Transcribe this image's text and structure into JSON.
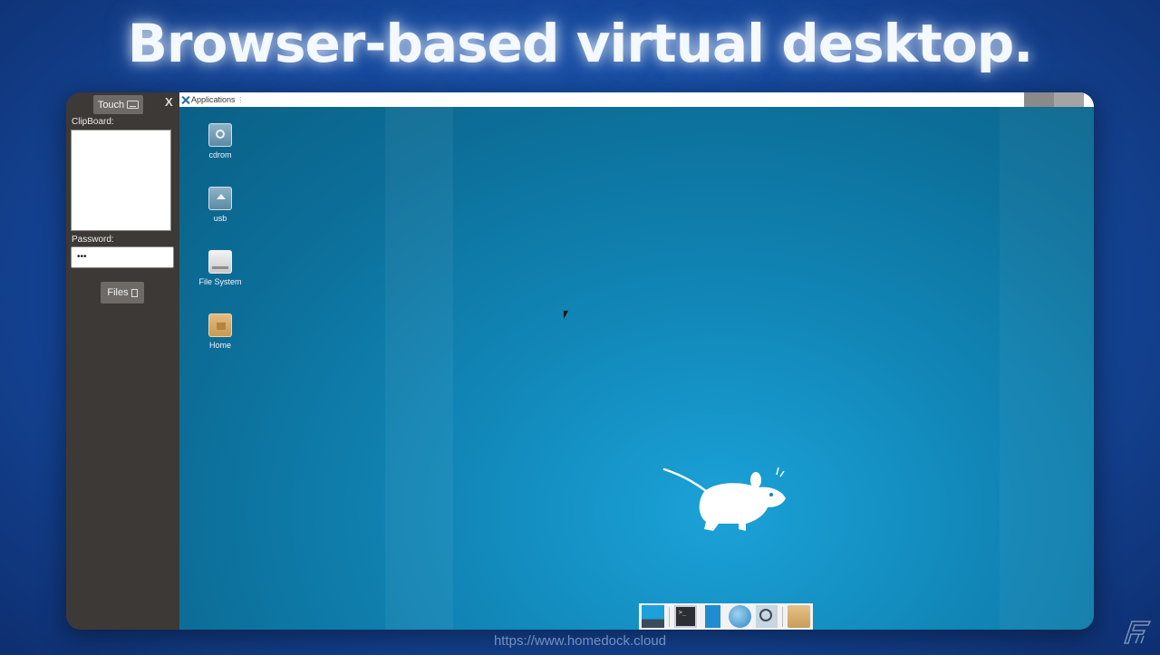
{
  "headline": "Browser-based virtual desktop.",
  "side_panel": {
    "touch_label": "Touch",
    "close_label": "X",
    "clipboard_label": "ClipBoard:",
    "clipboard_value": "",
    "password_label": "Password:",
    "password_value": "•••",
    "files_label": "Files"
  },
  "desktop": {
    "menu_label": "Applications",
    "icons": [
      {
        "label": "cdrom",
        "icon": "cdrom-icon"
      },
      {
        "label": "usb",
        "icon": "usb-drive-icon"
      },
      {
        "label": "File System",
        "icon": "filesystem-icon"
      },
      {
        "label": "Home",
        "icon": "home-folder-icon"
      }
    ],
    "dock": [
      "show-desktop-icon",
      "terminal-icon",
      "file-manager-icon",
      "web-browser-icon",
      "app-finder-icon",
      "folder-icon"
    ]
  },
  "footer_url": "https://www.homedock.cloud",
  "colors": {
    "desktop": "#1187b8",
    "panel": "#3c3936",
    "background": "#15479a"
  }
}
